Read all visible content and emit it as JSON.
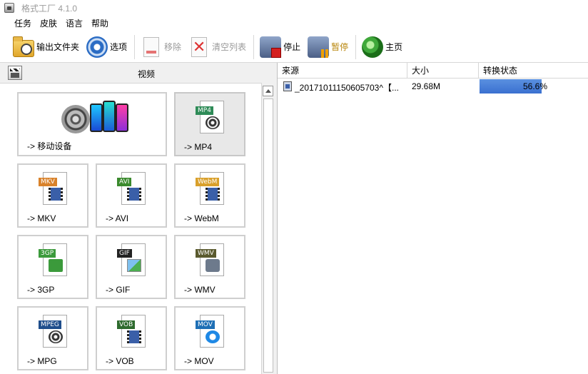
{
  "window": {
    "title": "格式工厂 4.1.0"
  },
  "menu": [
    "任务",
    "皮肤",
    "语言",
    "帮助"
  ],
  "toolbar": {
    "output_folder": "输出文件夹",
    "options": "选项",
    "remove": "移除",
    "clear_list": "清空列表",
    "stop": "停止",
    "pause": "暂停",
    "home": "主页"
  },
  "left_panel": {
    "title": "视频",
    "tiles": [
      {
        "label": "-> 移动设备",
        "icon": "mobile-devices-icon"
      },
      {
        "label": "-> MP4",
        "tag": "MP4",
        "tag_color": "#2e8b57",
        "icon": "mp4-file-icon"
      },
      {
        "label": "-> MKV",
        "tag": "MKV",
        "tag_color": "#d9822b",
        "icon": "mkv-file-icon"
      },
      {
        "label": "-> AVI",
        "tag": "AVI",
        "tag_color": "#3b8a2e",
        "icon": "avi-file-icon"
      },
      {
        "label": "-> WebM",
        "tag": "WebM",
        "tag_color": "#d9a02b",
        "icon": "webm-file-icon"
      },
      {
        "label": "-> 3GP",
        "tag": "3GP",
        "tag_color": "#3b9a3b",
        "icon": "3gp-file-icon"
      },
      {
        "label": "-> GIF",
        "tag": "GIF",
        "tag_color": "#222222",
        "icon": "gif-file-icon"
      },
      {
        "label": "-> WMV",
        "tag": "WMV",
        "tag_color": "#5a5a2e",
        "icon": "wmv-file-icon"
      },
      {
        "label": "-> MPG",
        "tag": "MPEG",
        "tag_color": "#1f4e8c",
        "icon": "mpg-file-icon"
      },
      {
        "label": "-> VOB",
        "tag": "VOB",
        "tag_color": "#2e6b2e",
        "icon": "vob-file-icon"
      },
      {
        "label": "-> MOV",
        "tag": "MOV",
        "tag_color": "#1e6fb5",
        "icon": "mov-file-icon"
      }
    ]
  },
  "task_list": {
    "columns": [
      "来源",
      "大小",
      "转换状态"
    ],
    "rows": [
      {
        "source": "_20171011150605703^【...",
        "size": "29.68M",
        "status": "56.6%",
        "progress": 0.566
      }
    ]
  }
}
